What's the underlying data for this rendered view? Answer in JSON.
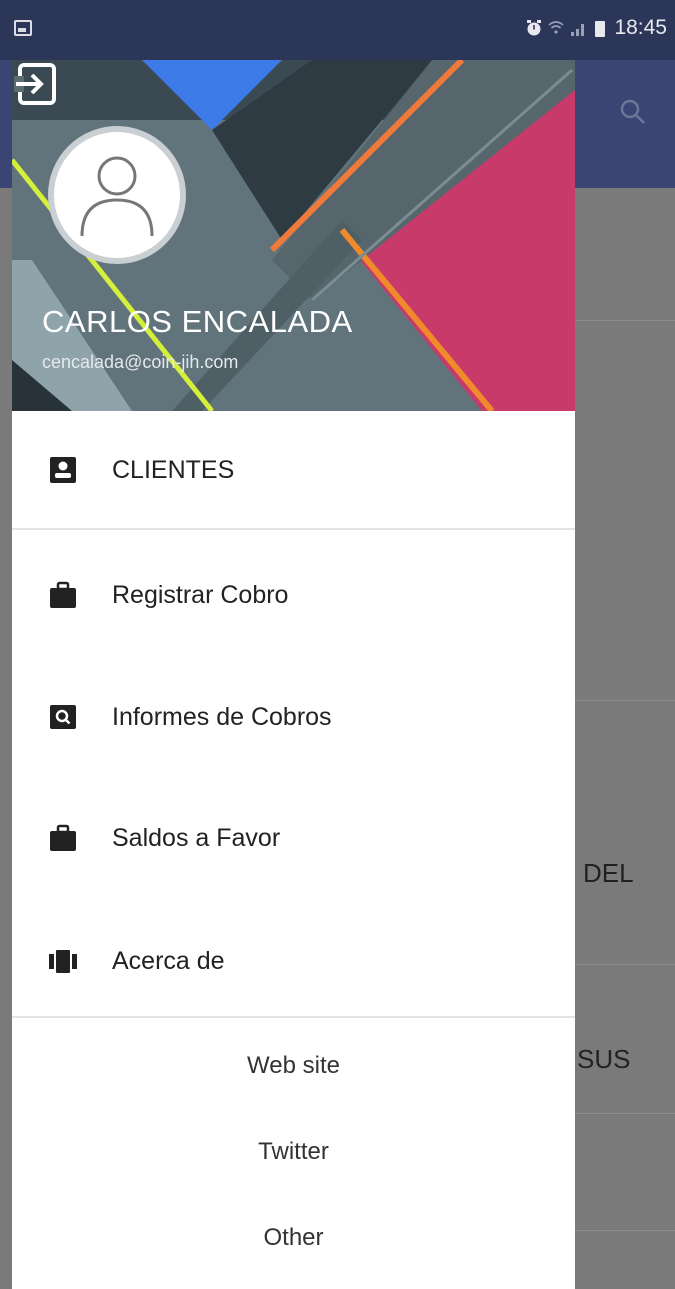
{
  "status_bar": {
    "time": "18:45"
  },
  "background": {
    "text_del": "DEL",
    "text_sus": "SUS"
  },
  "drawer": {
    "user": {
      "name": "CARLOS ENCALADA",
      "email": "cencalada@coin-jih.com"
    },
    "logout_icon": "logout-icon",
    "menu": [
      {
        "label": "CLIENTES",
        "icon": "contact-card-icon"
      },
      {
        "label": "Registrar Cobro",
        "icon": "briefcase-icon"
      },
      {
        "label": "Informes de Cobros",
        "icon": "search-report-icon"
      },
      {
        "label": "Saldos a Favor",
        "icon": "briefcase-icon"
      },
      {
        "label": "Acerca de",
        "icon": "carousel-icon"
      }
    ],
    "footer_links": [
      "Web site",
      "Twitter",
      "Other"
    ]
  },
  "colors": {
    "status_bar": "#2b3658",
    "app_bar": "#3a4573",
    "scrim": "#7a7a7a",
    "header_pink": "#c83a6a",
    "header_orange": "#f07a3a",
    "header_yellow_green": "#d4f03a",
    "header_blue": "#3d7be8"
  }
}
